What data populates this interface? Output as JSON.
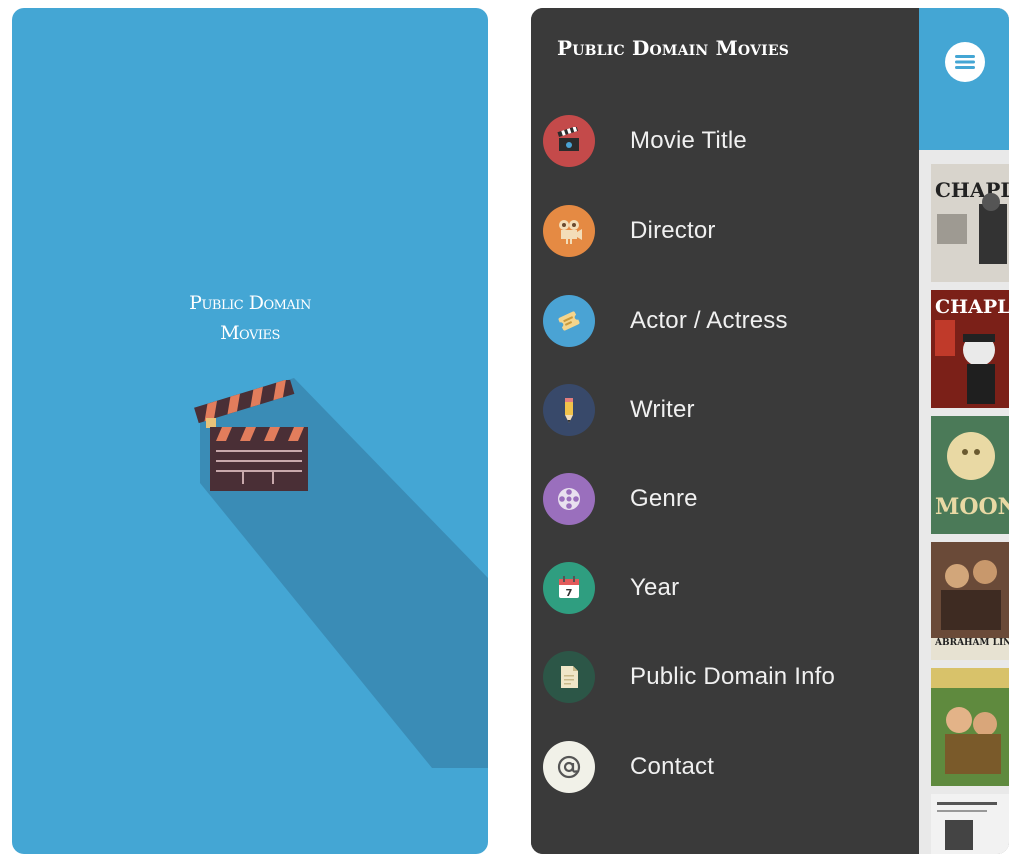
{
  "splash": {
    "title_line1": "Public Domain",
    "title_line2": "Movies"
  },
  "drawer": {
    "title": "Public Domain Movies",
    "items": [
      {
        "label": "Movie Title",
        "icon": "clapperboard-icon",
        "color": "#c44a4a"
      },
      {
        "label": "Director",
        "icon": "movie-camera-icon",
        "color": "#e58a43"
      },
      {
        "label": "Actor / Actress",
        "icon": "ticket-icon",
        "color": "#4aa3d4"
      },
      {
        "label": "Writer",
        "icon": "pencil-icon",
        "color": "#38496a"
      },
      {
        "label": "Genre",
        "icon": "film-reel-icon",
        "color": "#9a6fbd"
      },
      {
        "label": "Year",
        "icon": "calendar-icon",
        "color": "#2f9e80"
      },
      {
        "label": "Public Domain Info",
        "icon": "document-icon",
        "color": "#2c5647"
      },
      {
        "label": "Contact",
        "icon": "at-sign-icon",
        "color": "#f1f1e8"
      }
    ]
  },
  "content": {
    "menu_icon": "hamburger-menu-icon",
    "posters": [
      {
        "text": "CHAPLIN",
        "bg": "#d8d4cc",
        "fg": "#222222"
      },
      {
        "text": "CHAPLIN",
        "bg": "#7b2018",
        "fg": "#ffffff"
      },
      {
        "text": "MOON",
        "bg": "#4b7a58",
        "fg": "#e9d9a4"
      },
      {
        "text": "ABRAHAM LINCOLN",
        "bg": "#6a4a38",
        "fg": "#ffffff"
      },
      {
        "text": "",
        "bg": "#5f8a3e",
        "fg": "#ffffff"
      },
      {
        "text": "",
        "bg": "#f2f2f2",
        "fg": "#222222"
      }
    ]
  },
  "colors": {
    "accent_blue": "#44a6d4",
    "drawer_bg": "#3a3a3a"
  }
}
